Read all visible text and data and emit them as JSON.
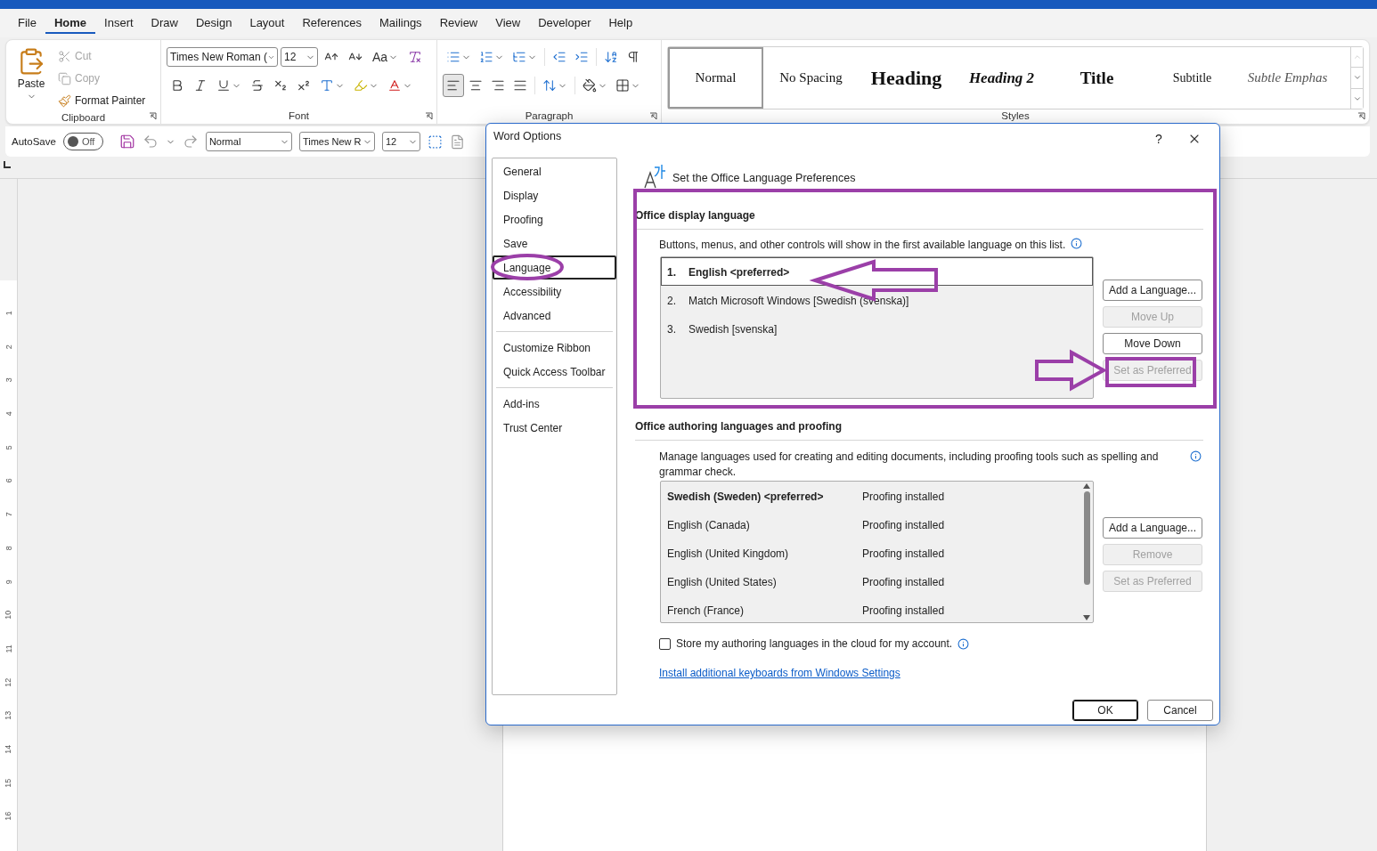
{
  "ribbon_tabs": [
    {
      "label": "File",
      "selected": false
    },
    {
      "label": "Home",
      "selected": true
    },
    {
      "label": "Insert",
      "selected": false
    },
    {
      "label": "Draw",
      "selected": false
    },
    {
      "label": "Design",
      "selected": false
    },
    {
      "label": "Layout",
      "selected": false
    },
    {
      "label": "References",
      "selected": false
    },
    {
      "label": "Mailings",
      "selected": false
    },
    {
      "label": "Review",
      "selected": false
    },
    {
      "label": "View",
      "selected": false
    },
    {
      "label": "Developer",
      "selected": false
    },
    {
      "label": "Help",
      "selected": false
    }
  ],
  "clipboard": {
    "paste": "Paste",
    "label": "Clipboard",
    "actions": [
      {
        "kind": "cut",
        "label": "Cut",
        "disabled": true
      },
      {
        "kind": "copy",
        "label": "Copy",
        "disabled": true
      },
      {
        "kind": "format_painter",
        "label": "Format Painter",
        "disabled": false
      }
    ]
  },
  "font": {
    "name": "Times New Roman (",
    "size": "12",
    "case_button": "Aa",
    "label": "Font"
  },
  "paragraph": {
    "label": "Paragraph",
    "alignment": [
      {
        "kind": "left",
        "selected": true
      },
      {
        "kind": "center",
        "selected": false
      },
      {
        "kind": "right",
        "selected": false
      },
      {
        "kind": "justify",
        "selected": false
      }
    ]
  },
  "styles": {
    "label": "Styles",
    "items": [
      {
        "kind": "normal",
        "label": "Normal",
        "selected": true
      },
      {
        "kind": "no_spacing",
        "label": "No Spacing",
        "selected": false
      },
      {
        "kind": "heading1",
        "label": "Heading",
        "selected": false
      },
      {
        "kind": "heading2",
        "label": "Heading 2",
        "selected": false
      },
      {
        "kind": "title",
        "label": "Title",
        "selected": false
      },
      {
        "kind": "subtitle",
        "label": "Subtitle",
        "selected": false
      },
      {
        "kind": "emphasis",
        "label": "Subtle Emphas",
        "selected": false
      }
    ]
  },
  "quick_access": {
    "autosave": {
      "label": "AutoSave",
      "on": false,
      "state_label": "Off"
    },
    "style": "Normal",
    "font": "Times New R",
    "size": "12"
  },
  "ruler": {
    "numbers": [
      "1",
      "2",
      "3",
      "4",
      "5",
      "6",
      "7",
      "8",
      "9",
      "10",
      "11",
      "12",
      "13",
      "14",
      "15",
      "16"
    ]
  },
  "dialog": {
    "title": "Word Options",
    "help": "?",
    "nav": [
      {
        "items": [
          {
            "label": "General",
            "selected": false
          },
          {
            "label": "Display",
            "selected": false
          },
          {
            "label": "Proofing",
            "selected": false
          },
          {
            "label": "Save",
            "selected": false
          },
          {
            "label": "Language",
            "selected": true
          },
          {
            "label": "Accessibility",
            "selected": false
          },
          {
            "label": "Advanced",
            "selected": false
          }
        ]
      },
      {
        "items": [
          {
            "label": "Customize Ribbon",
            "selected": false
          },
          {
            "label": "Quick Access Toolbar",
            "selected": false
          }
        ]
      },
      {
        "items": [
          {
            "label": "Add-ins",
            "selected": false
          },
          {
            "label": "Trust Center",
            "selected": false
          }
        ]
      }
    ],
    "heading": "Set the Office Language Preferences",
    "display_language": {
      "title": "Office display language",
      "description": "Buttons, menus, and other controls will show in the first available language on this list.",
      "languages": [
        {
          "number": "1.",
          "label": "English <preferred>",
          "selected": true
        },
        {
          "number": "2.",
          "label": "Match Microsoft Windows [Swedish (svenska)]",
          "selected": false
        },
        {
          "number": "3.",
          "label": "Swedish [svenska]",
          "selected": false
        }
      ],
      "buttons": [
        {
          "label": "Add a Language...",
          "disabled": false
        },
        {
          "label": "Move Up",
          "disabled": true
        },
        {
          "label": "Move Down",
          "disabled": false
        },
        {
          "label": "Set as Preferred",
          "disabled": true
        }
      ]
    },
    "authoring_languages": {
      "title": "Office authoring languages and proofing",
      "description": "Manage languages used for creating and editing documents, including proofing tools such as spelling and grammar check.",
      "languages": [
        {
          "language": "Swedish (Sweden) <preferred>",
          "status": "Proofing installed",
          "preferred": true
        },
        {
          "language": "English (Canada)",
          "status": "Proofing installed",
          "preferred": false
        },
        {
          "language": "English (United Kingdom)",
          "status": "Proofing installed",
          "preferred": false
        },
        {
          "language": "English (United States)",
          "status": "Proofing installed",
          "preferred": false
        },
        {
          "language": "French (France)",
          "status": "Proofing installed",
          "preferred": false
        }
      ],
      "buttons": [
        {
          "label": "Add a Language...",
          "disabled": false
        },
        {
          "label": "Remove",
          "disabled": true
        },
        {
          "label": "Set as Preferred",
          "disabled": true
        }
      ]
    },
    "cloud_option": {
      "label": "Store my authoring languages in the cloud for my account.",
      "checked": false
    },
    "link": "Install additional keyboards from Windows Settings",
    "buttons": [
      {
        "label": "OK",
        "default": true
      },
      {
        "label": "Cancel",
        "default": false
      }
    ]
  }
}
